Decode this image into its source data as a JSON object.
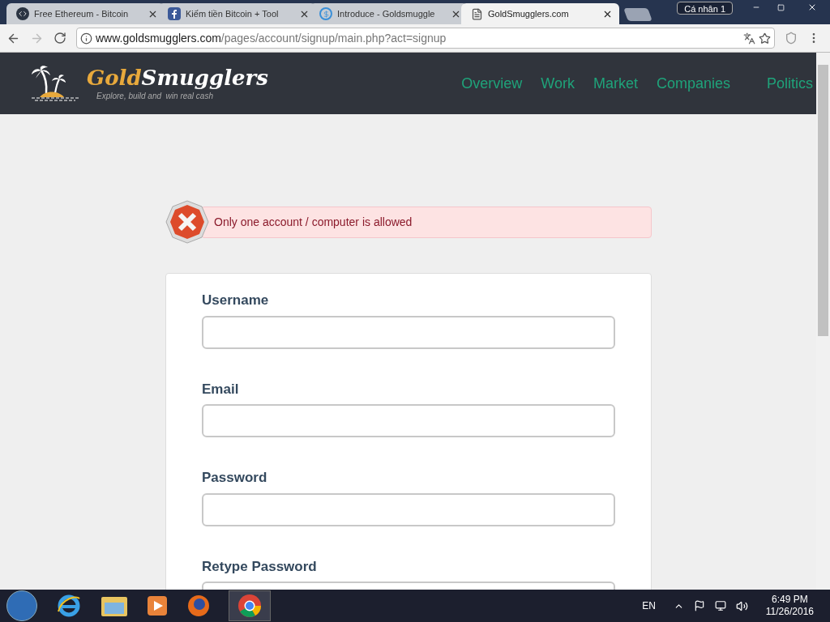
{
  "browser": {
    "tabs": [
      {
        "title": "Free Ethereum - Bitcoin",
        "selected": false
      },
      {
        "title": "Kiếm tiền Bitcoin + Tool",
        "selected": false
      },
      {
        "title": "Introduce - Goldsmuggle",
        "selected": false
      },
      {
        "title": "GoldSmugglers.com",
        "selected": true
      }
    ],
    "profile": "Cá nhân 1",
    "url_host": "www.goldsmugglers.com",
    "url_path": "/pages/account/signup/main.php?act=signup"
  },
  "site": {
    "logo_gold": "Gold",
    "logo_rest": "Smugglers",
    "tagline": "Explore, build and  win real cash",
    "nav": [
      "Overview",
      "Work",
      "Market",
      "Companies",
      "Politics"
    ]
  },
  "alert": {
    "message": "Only one account / computer is allowed"
  },
  "form": {
    "fields": [
      {
        "label": "Username"
      },
      {
        "label": "Email"
      },
      {
        "label": "Password"
      },
      {
        "label": "Retype Password"
      }
    ]
  },
  "taskbar": {
    "language": "EN",
    "time": "6:49 PM",
    "date": "11/26/2016"
  }
}
